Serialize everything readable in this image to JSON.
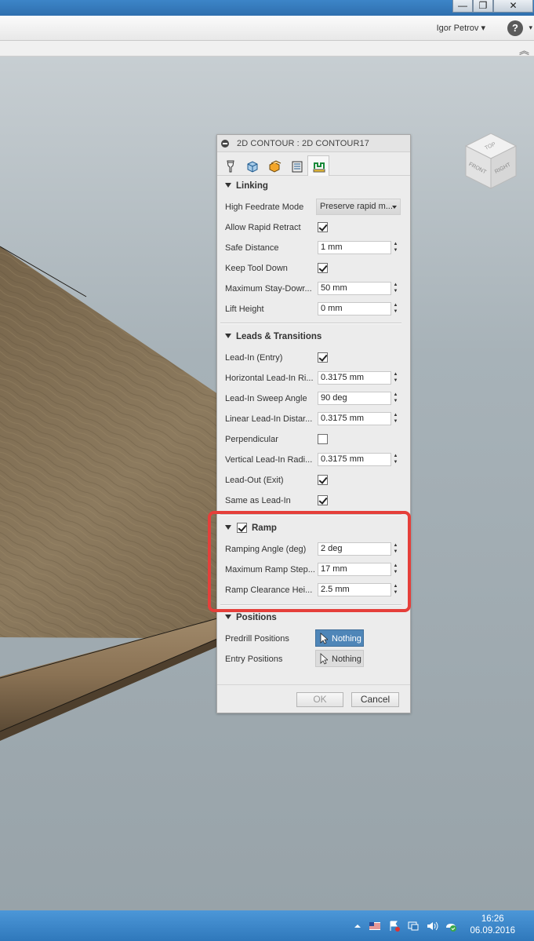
{
  "window": {
    "minimize_glyph": "—",
    "maximize_glyph": "❐",
    "close_glyph": "✕"
  },
  "toolbar": {
    "user_name": "Igor Petrov ▾",
    "help_glyph": "?",
    "help_caret": "▾",
    "collapse_glyph": "︽"
  },
  "viewcube": {
    "top": "TOP",
    "front": "FRONT",
    "right": "RIGHT"
  },
  "dialog": {
    "title": "2D CONTOUR : 2D CONTOUR17",
    "tabs": [
      "tool-icon",
      "geometry-icon",
      "heights-icon",
      "passes-icon",
      "linking-icon"
    ],
    "active_tab": 4,
    "linking": {
      "header": "Linking",
      "high_feedrate_mode": {
        "label": "High Feedrate Mode",
        "value": "Preserve rapid m..."
      },
      "allow_rapid_retract": {
        "label": "Allow Rapid Retract",
        "checked": true
      },
      "safe_distance": {
        "label": "Safe Distance",
        "value": "1 mm"
      },
      "keep_tool_down": {
        "label": "Keep Tool Down",
        "checked": true
      },
      "maximum_stay_down": {
        "label": "Maximum Stay-Dowr...",
        "value": "50 mm"
      },
      "lift_height": {
        "label": "Lift Height",
        "value": "0 mm"
      }
    },
    "leads": {
      "header": "Leads & Transitions",
      "lead_in": {
        "label": "Lead-In (Entry)",
        "checked": true
      },
      "horizontal_lead_in_radius": {
        "label": "Horizontal Lead-In Ri...",
        "value": "0.3175 mm"
      },
      "lead_in_sweep_angle": {
        "label": "Lead-In Sweep Angle",
        "value": "90 deg"
      },
      "linear_lead_in_distance": {
        "label": "Linear Lead-In Distar...",
        "value": "0.3175 mm"
      },
      "perpendicular": {
        "label": "Perpendicular",
        "checked": false
      },
      "vertical_lead_in_radius": {
        "label": "Vertical Lead-In Radi...",
        "value": "0.3175 mm"
      },
      "lead_out": {
        "label": "Lead-Out (Exit)",
        "checked": true
      },
      "same_as_lead_in": {
        "label": "Same as Lead-In",
        "checked": true
      }
    },
    "ramp": {
      "header": "Ramp",
      "enabled": true,
      "ramping_angle": {
        "label": "Ramping Angle (deg)",
        "value": "2 deg"
      },
      "maximum_ramp_stepdown": {
        "label": "Maximum Ramp Step...",
        "value": "17 mm"
      },
      "ramp_clearance_height": {
        "label": "Ramp Clearance Hei...",
        "value": "2.5 mm"
      }
    },
    "positions": {
      "header": "Positions",
      "predrill": {
        "label": "Predrill Positions",
        "value": "Nothing"
      },
      "entry": {
        "label": "Entry Positions",
        "value": "Nothing"
      }
    },
    "ok_label": "OK",
    "cancel_label": "Cancel"
  },
  "highlight_color": "#e53f3a",
  "taskbar": {
    "tray_icons": [
      "show-hidden-icons",
      "flag-us-icon",
      "action-center-icon",
      "network-icon",
      "volume-icon",
      "sync-icon"
    ],
    "time": "16:26",
    "date": "06.09.2016"
  }
}
